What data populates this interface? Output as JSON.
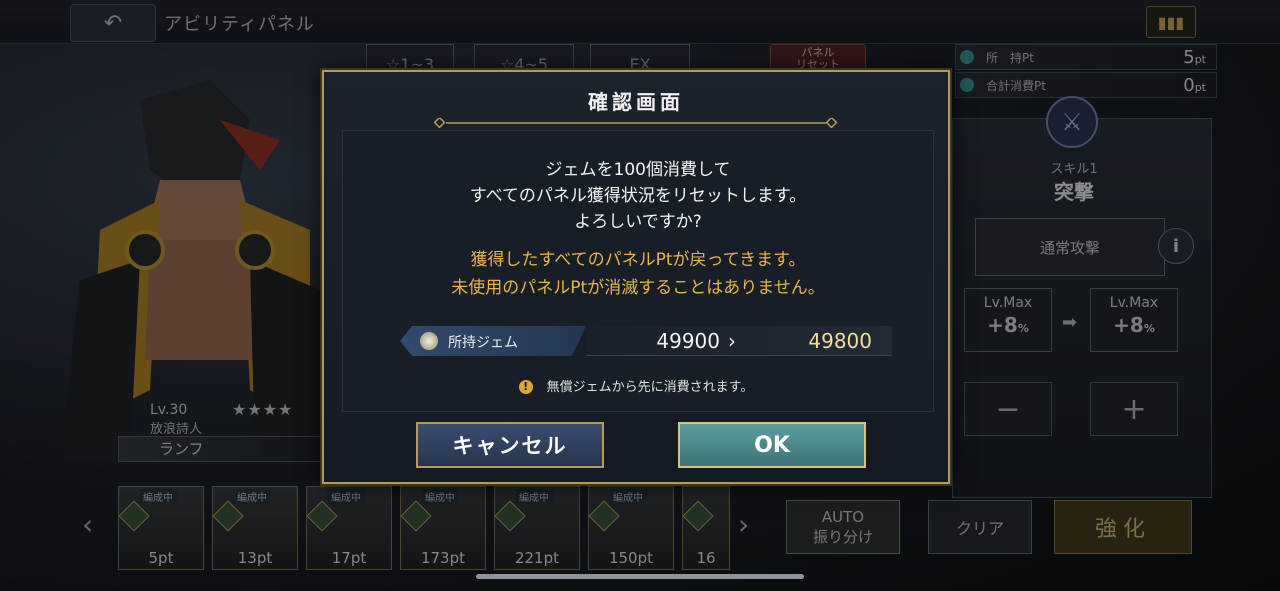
{
  "header": {
    "title": "アビリティパネル"
  },
  "tabs": [
    {
      "label": "☆1~3"
    },
    {
      "label": "☆4~5"
    },
    {
      "label": "EX"
    }
  ],
  "panel_reset": "パネル\nリセット",
  "points": {
    "owned_label": "所　持Pt",
    "owned_value": "5",
    "used_label": "合計消費Pt",
    "used_value": "0",
    "unit": "pt"
  },
  "skill": {
    "number": "スキル1",
    "name": "突撃",
    "attack_type": "通常攻撃",
    "lv_before": "Lv.Max",
    "lv_before_value": "+8",
    "lv_after": "Lv.Max",
    "lv_after_value": "+8",
    "percent": "%"
  },
  "character": {
    "level": "Lv.30",
    "stars": "★★★★",
    "job": "放浪詩人",
    "name": "ランフ"
  },
  "party": [
    {
      "pt": "5pt",
      "badge": "編成中"
    },
    {
      "pt": "13pt",
      "badge": "編成中"
    },
    {
      "pt": "17pt",
      "badge": "編成中"
    },
    {
      "pt": "173pt",
      "badge": "編成中"
    },
    {
      "pt": "221pt",
      "badge": "編成中"
    },
    {
      "pt": "150pt",
      "badge": "編成中"
    },
    {
      "pt": "16",
      "badge": ""
    }
  ],
  "bottom_buttons": {
    "auto": "AUTO\n振り分け",
    "clear": "クリア",
    "enhance": "強化"
  },
  "dialog": {
    "title": "確認画面",
    "message_lines": [
      "ジェムを100個消費して",
      "すべてのパネル獲得状況をリセットします。",
      "よろしいですか?"
    ],
    "warning_lines": [
      "獲得したすべてのパネルPtが戻ってきます。",
      "未使用のパネルPtが消滅することはありません。"
    ],
    "gem_label": "所持ジェム",
    "gem_before": "49900",
    "gem_arrow": "›",
    "gem_after": "49800",
    "note": "無償ジェムから先に消費されます。",
    "note_icon": "!",
    "cancel_label": "キャンセル",
    "ok_label": "OK"
  },
  "colors": {
    "gold_border": "#b59a58",
    "warning_text": "#e8b44a",
    "ok_button": "#5c9ea0",
    "cancel_button": "#3a4e70"
  }
}
